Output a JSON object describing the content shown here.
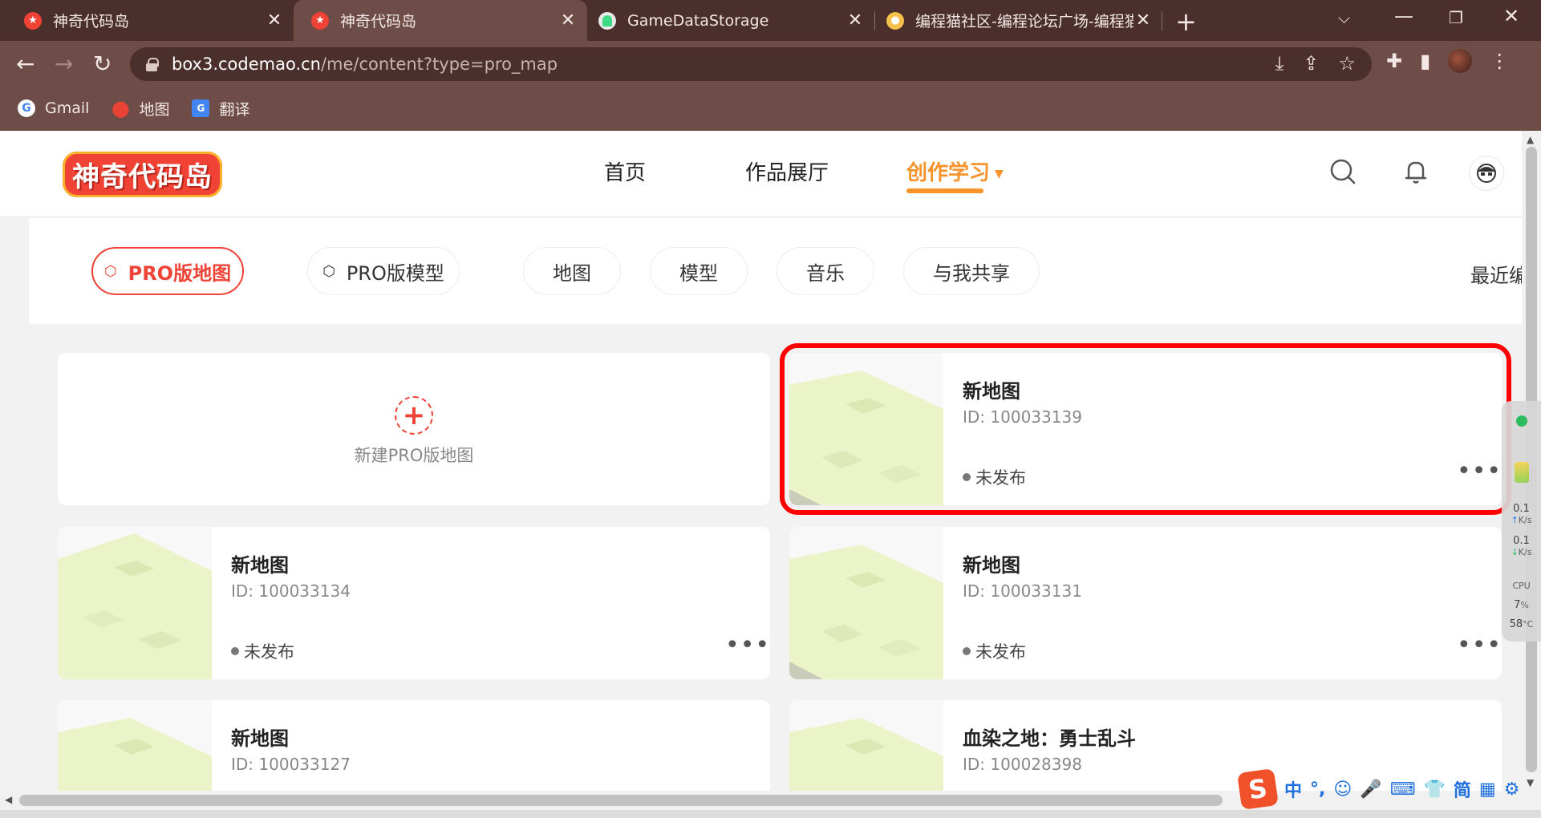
{
  "browser": {
    "tabs": [
      {
        "title": "神奇代码岛",
        "active": false
      },
      {
        "title": "神奇代码岛",
        "active": true
      },
      {
        "title": "GameDataStorage",
        "active": false
      },
      {
        "title": "编程猫社区-编程论坛广场-编程猫",
        "active": false
      }
    ],
    "url_host": "box3.codemao.cn",
    "url_path": "/me/content?type=pro_map",
    "bookmarks": [
      {
        "label": "Gmail",
        "icon": "google-icon"
      },
      {
        "label": "地图",
        "icon": "maps-pin-icon"
      },
      {
        "label": "翻译",
        "icon": "translate-icon"
      }
    ],
    "colors": {
      "frame": "#4a2f2c",
      "toolbar": "#6e4c48"
    }
  },
  "site": {
    "logo_text": "神奇代码岛",
    "nav": [
      {
        "label": "首页",
        "active": false
      },
      {
        "label": "作品展厅",
        "active": false
      },
      {
        "label": "创作学习",
        "active": true
      }
    ],
    "accent": "#f7932a",
    "brand_red": "#f04336"
  },
  "filters": {
    "items": [
      {
        "label": "PRO版地图",
        "icon": "hexagon-icon",
        "active": true
      },
      {
        "label": "PRO版模型",
        "icon": "hexagon-icon",
        "active": false
      },
      {
        "label": "地图",
        "active": false
      },
      {
        "label": "模型",
        "active": false
      },
      {
        "label": "音乐",
        "active": false
      },
      {
        "label": "与我共享",
        "active": false
      }
    ],
    "sort_label": "最近编辑"
  },
  "new_card": {
    "label": "新建PRO版地图",
    "icon": "plus-icon"
  },
  "cards": [
    {
      "title": "新地图",
      "id": "ID: 100033139",
      "status": "未发布",
      "selected": true
    },
    {
      "title": "新地图",
      "id": "ID: 100033134",
      "status": "未发布",
      "selected": false
    },
    {
      "title": "新地图",
      "id": "ID: 100033131",
      "status": "未发布",
      "selected": false
    },
    {
      "title": "新地图",
      "id": "ID: 100033127",
      "status": "",
      "selected": false
    },
    {
      "title": "血染之地：勇士乱斗",
      "id": "ID: 100028398",
      "status": "",
      "selected": false
    }
  ],
  "card_more_label": "•••",
  "monitor": {
    "up_value": "0.1",
    "up_unit": "K/s",
    "down_value": "0.1",
    "down_unit": "K/s",
    "cpu_label": "CPU",
    "cpu_value": "7",
    "cpu_unit": "%",
    "temp_value": "58",
    "temp_unit": "°C"
  },
  "ime": {
    "logo": "S",
    "items": [
      "中",
      "°,",
      "☺",
      "🎤",
      "⌨",
      "👕",
      "简",
      "▦",
      "⚙"
    ]
  }
}
